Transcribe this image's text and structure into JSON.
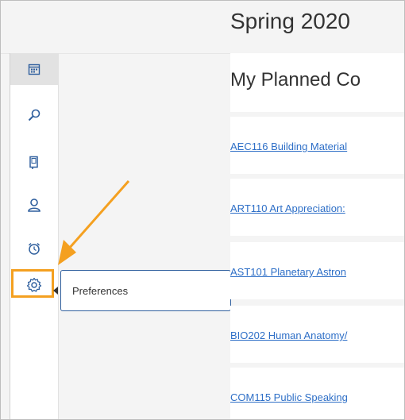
{
  "term": {
    "title": "Spring 2020"
  },
  "panel": {
    "title": "My Planned Co"
  },
  "courses": [
    {
      "label": "AEC116 Building Material"
    },
    {
      "label": "ART110 Art Appreciation:"
    },
    {
      "label": "AST101 Planetary Astron"
    },
    {
      "label": "BIO202 Human Anatomy/"
    },
    {
      "label": "COM115 Public Speaking"
    }
  ],
  "sidebar": {
    "items": [
      {
        "icon": "calendar-icon",
        "active": true
      },
      {
        "icon": "search-icon"
      },
      {
        "icon": "device-icon"
      },
      {
        "icon": "person-icon"
      },
      {
        "icon": "alarm-clock-icon"
      },
      {
        "icon": "gear-icon"
      }
    ]
  },
  "tooltip": {
    "label": "Preferences"
  },
  "colors": {
    "link": "#2e6fc7",
    "highlight": "#f4a020",
    "tooltip_border": "#2f5f9e",
    "icon": "#2f5f9e"
  }
}
